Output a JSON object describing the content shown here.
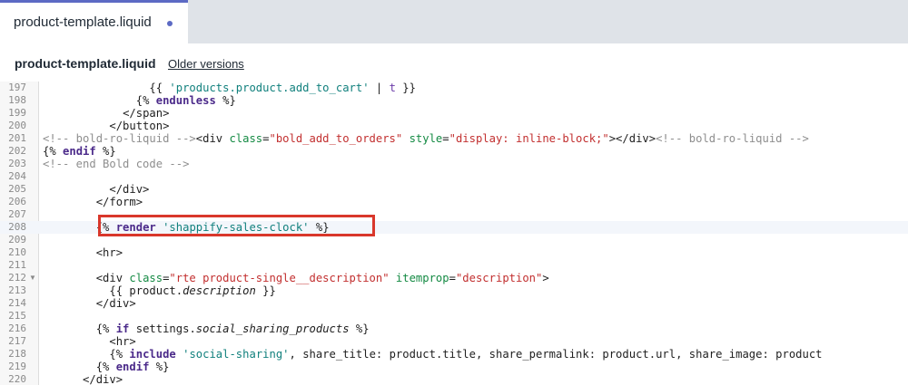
{
  "tab": {
    "label": "product-template.liquid"
  },
  "header": {
    "file_name": "product-template.liquid",
    "older_versions": "Older versions"
  },
  "colors": {
    "accent": "#5c6ac4",
    "highlight": "#d9372b"
  },
  "editor": {
    "lines": [
      {
        "n": "197",
        "indent": "                ",
        "tokens": [
          [
            "t-tag",
            "{{ "
          ],
          [
            "t-str",
            "'products.product.add_to_cart'"
          ],
          [
            "t-tag",
            " | "
          ],
          [
            "t-filter",
            "t"
          ],
          [
            "t-tag",
            " }}"
          ]
        ]
      },
      {
        "n": "198",
        "indent": "              ",
        "tokens": [
          [
            "t-tag",
            "{% "
          ],
          [
            "t-kw",
            "endunless"
          ],
          [
            "t-tag",
            " %}"
          ]
        ]
      },
      {
        "n": "199",
        "indent": "            ",
        "tokens": [
          [
            "t-tag",
            "</span>"
          ]
        ]
      },
      {
        "n": "200",
        "indent": "          ",
        "tokens": [
          [
            "t-tag",
            "</button>"
          ]
        ]
      },
      {
        "n": "201",
        "indent": "",
        "tokens": [
          [
            "t-com",
            "<!-- bold-ro-liquid -->"
          ],
          [
            "t-tag",
            "<div "
          ],
          [
            "t-attr",
            "class"
          ],
          [
            "t-tag",
            "="
          ],
          [
            "t-val",
            "\"bold_add_to_orders\""
          ],
          [
            "t-tag",
            " "
          ],
          [
            "t-attr",
            "style"
          ],
          [
            "t-tag",
            "="
          ],
          [
            "t-val",
            "\"display: inline-block;\""
          ],
          [
            "t-tag",
            "></div>"
          ],
          [
            "t-com",
            "<!-- bold-ro-liquid -->"
          ]
        ]
      },
      {
        "n": "202",
        "indent": "",
        "tokens": [
          [
            "t-tag",
            "{% "
          ],
          [
            "t-kw",
            "endif"
          ],
          [
            "t-tag",
            " %}"
          ]
        ]
      },
      {
        "n": "203",
        "indent": "",
        "tokens": [
          [
            "t-com",
            "<!-- end Bold code -->"
          ]
        ]
      },
      {
        "n": "204",
        "indent": "",
        "tokens": []
      },
      {
        "n": "205",
        "indent": "          ",
        "tokens": [
          [
            "t-tag",
            "</div>"
          ]
        ]
      },
      {
        "n": "206",
        "indent": "        ",
        "tokens": [
          [
            "t-tag",
            "</form>"
          ]
        ]
      },
      {
        "n": "207",
        "indent": "",
        "tokens": []
      },
      {
        "n": "208",
        "indent": "        ",
        "active": true,
        "tokens": [
          [
            "t-tag",
            "{% "
          ],
          [
            "t-kw",
            "render"
          ],
          [
            "t-tag",
            " "
          ],
          [
            "t-str",
            "'shappify-sales-clock'"
          ],
          [
            "t-tag",
            " %}"
          ]
        ]
      },
      {
        "n": "209",
        "indent": "",
        "tokens": []
      },
      {
        "n": "210",
        "indent": "        ",
        "tokens": [
          [
            "t-tag",
            "<hr>"
          ]
        ]
      },
      {
        "n": "211",
        "indent": "",
        "tokens": []
      },
      {
        "n": "212",
        "indent": "        ",
        "fold": true,
        "tokens": [
          [
            "t-tag",
            "<div "
          ],
          [
            "t-attr",
            "class"
          ],
          [
            "t-tag",
            "="
          ],
          [
            "t-val",
            "\"rte product-single__description\""
          ],
          [
            "t-tag",
            " "
          ],
          [
            "t-attr",
            "itemprop"
          ],
          [
            "t-tag",
            "="
          ],
          [
            "t-val",
            "\"description\""
          ],
          [
            "t-tag",
            ">"
          ]
        ]
      },
      {
        "n": "213",
        "indent": "          ",
        "tokens": [
          [
            "t-tag",
            "{{ product."
          ],
          [
            "t-it",
            "description"
          ],
          [
            "t-tag",
            " }}"
          ]
        ]
      },
      {
        "n": "214",
        "indent": "        ",
        "tokens": [
          [
            "t-tag",
            "</div>"
          ]
        ]
      },
      {
        "n": "215",
        "indent": "",
        "tokens": []
      },
      {
        "n": "216",
        "indent": "        ",
        "tokens": [
          [
            "t-tag",
            "{% "
          ],
          [
            "t-kw",
            "if"
          ],
          [
            "t-tag",
            " settings."
          ],
          [
            "t-it",
            "social_sharing_products"
          ],
          [
            "t-tag",
            " %}"
          ]
        ]
      },
      {
        "n": "217",
        "indent": "          ",
        "tokens": [
          [
            "t-tag",
            "<hr>"
          ]
        ]
      },
      {
        "n": "218",
        "indent": "          ",
        "tokens": [
          [
            "t-tag",
            "{% "
          ],
          [
            "t-kw",
            "include"
          ],
          [
            "t-tag",
            " "
          ],
          [
            "t-str",
            "'social-sharing'"
          ],
          [
            "t-tag",
            ", share_title: product.title, share_permalink: product.url, share_image: product"
          ]
        ]
      },
      {
        "n": "219",
        "indent": "        ",
        "tokens": [
          [
            "t-tag",
            "{% "
          ],
          [
            "t-kw",
            "endif"
          ],
          [
            "t-tag",
            " %}"
          ]
        ]
      },
      {
        "n": "220",
        "indent": "      ",
        "tokens": [
          [
            "t-tag",
            "</div>"
          ]
        ]
      }
    ]
  }
}
